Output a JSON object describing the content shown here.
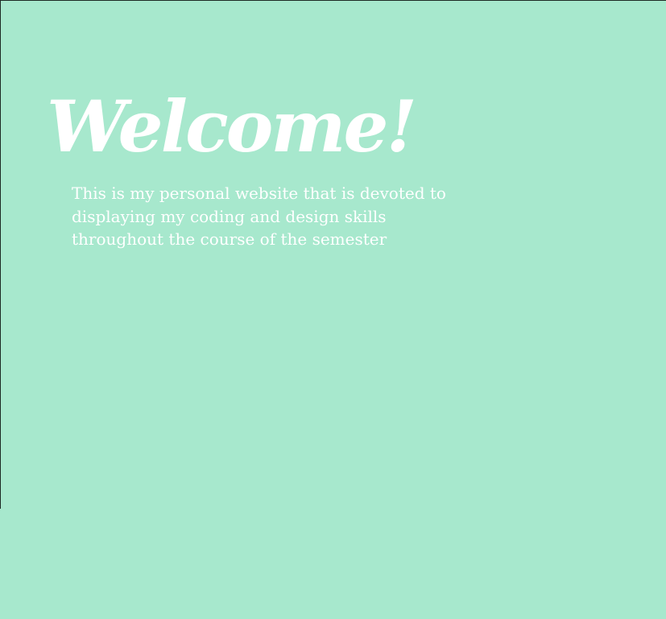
{
  "hero": {
    "title": "Welcome!",
    "intro": "This is my personal website that is devoted to displaying my coding and design skills throughout the course of the semester"
  },
  "colors": {
    "background": "#a7e8cd",
    "text": "#ffffff",
    "frame": "#1e2a25"
  }
}
